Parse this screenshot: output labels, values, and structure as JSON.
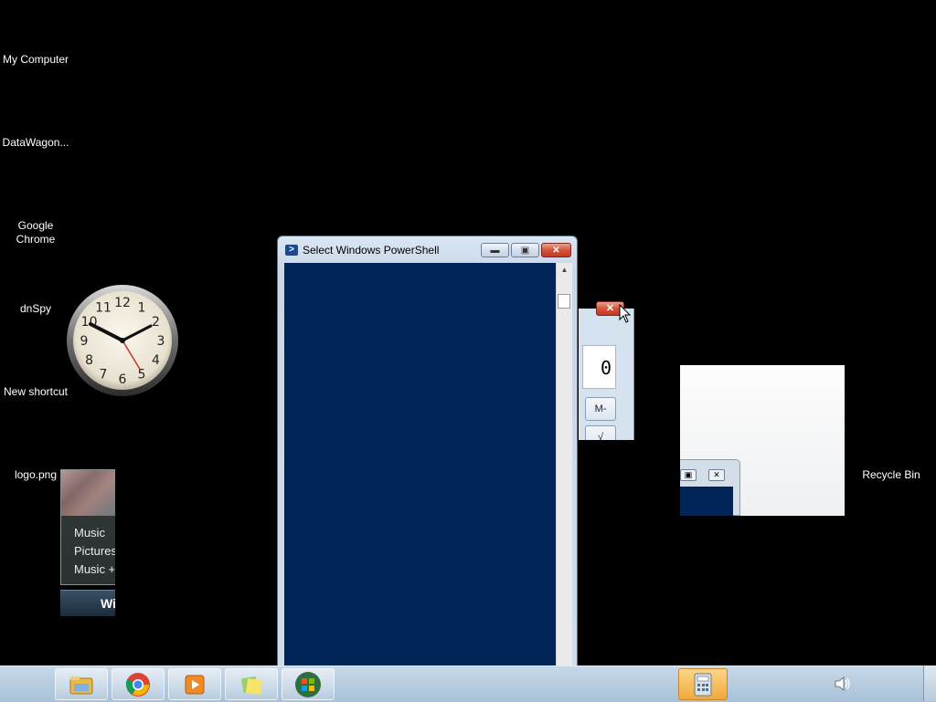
{
  "desktop": {
    "icons": [
      {
        "label": "My Computer"
      },
      {
        "label": "DataWagon..."
      },
      {
        "label": "Google Chrome"
      },
      {
        "label": "dnSpy"
      },
      {
        "label": "New shortcut"
      },
      {
        "label": "logo.png"
      },
      {
        "label": "Recycle Bin"
      }
    ]
  },
  "clock_gadget": {
    "numerals": [
      "12",
      "1",
      "2",
      "3",
      "4",
      "5",
      "6",
      "7",
      "8",
      "9",
      "10",
      "11"
    ]
  },
  "media_gadget": {
    "items": [
      "Music",
      "Pictures",
      "Music +"
    ],
    "banner": "Wi"
  },
  "powershell": {
    "title": "Select Windows PowerShell",
    "console_color": "#012456"
  },
  "calculator": {
    "display_value": "0",
    "keys": [
      "M-",
      "√"
    ]
  },
  "taskbar": {
    "buttons": [
      {
        "icon": "explorer-icon"
      },
      {
        "icon": "chrome-icon"
      },
      {
        "icon": "media-player-icon"
      },
      {
        "icon": "sticky-notes-icon"
      },
      {
        "icon": "windows-logo-icon"
      },
      {
        "icon": "calculator-icon",
        "active": true
      }
    ],
    "tray": {
      "icon": "speaker-icon"
    }
  }
}
